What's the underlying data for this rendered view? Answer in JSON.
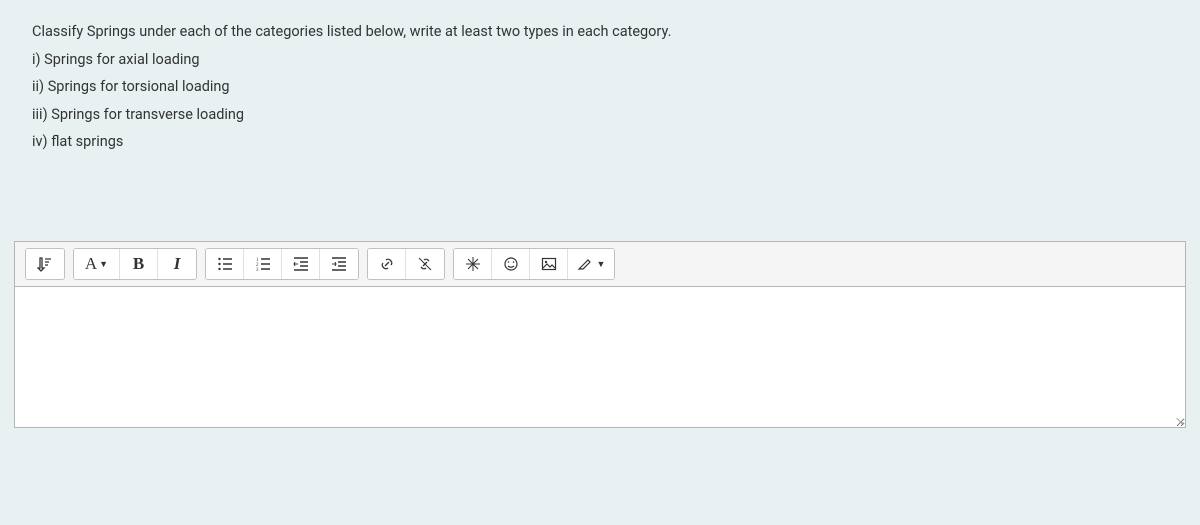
{
  "question": {
    "prompt": "Classify Springs under each of the categories listed below, write at least two types in each category.",
    "items": [
      "i) Springs for axial loading",
      "ii) Springs for torsional loading",
      "iii) Springs for transverse loading",
      "iv) flat springs"
    ]
  },
  "toolbar": {
    "expand": "⤵",
    "font_color": "A",
    "bold": "B",
    "italic": "I"
  }
}
